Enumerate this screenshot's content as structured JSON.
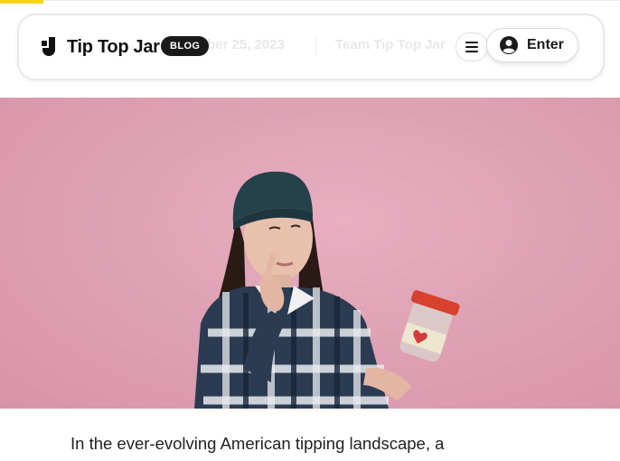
{
  "header": {
    "logo_text": "Tip Top Jar",
    "badge": "BLOG",
    "faded_date": "ber 25, 2023",
    "faded_author": "Team Tip Top Jar",
    "enter_label": "Enter"
  },
  "icons": {
    "logo": "logo-mark-icon",
    "menu": "hamburger-menu-icon",
    "user": "user-circle-icon"
  },
  "colors": {
    "progress": "#f7d21a",
    "hero_bg": "#dfa2b5",
    "badge_bg": "#1a1a1a"
  },
  "hero": {
    "image": "woman-holding-tip-jar"
  },
  "article": {
    "first_line": "In the ever-evolving American tipping landscape, a"
  }
}
